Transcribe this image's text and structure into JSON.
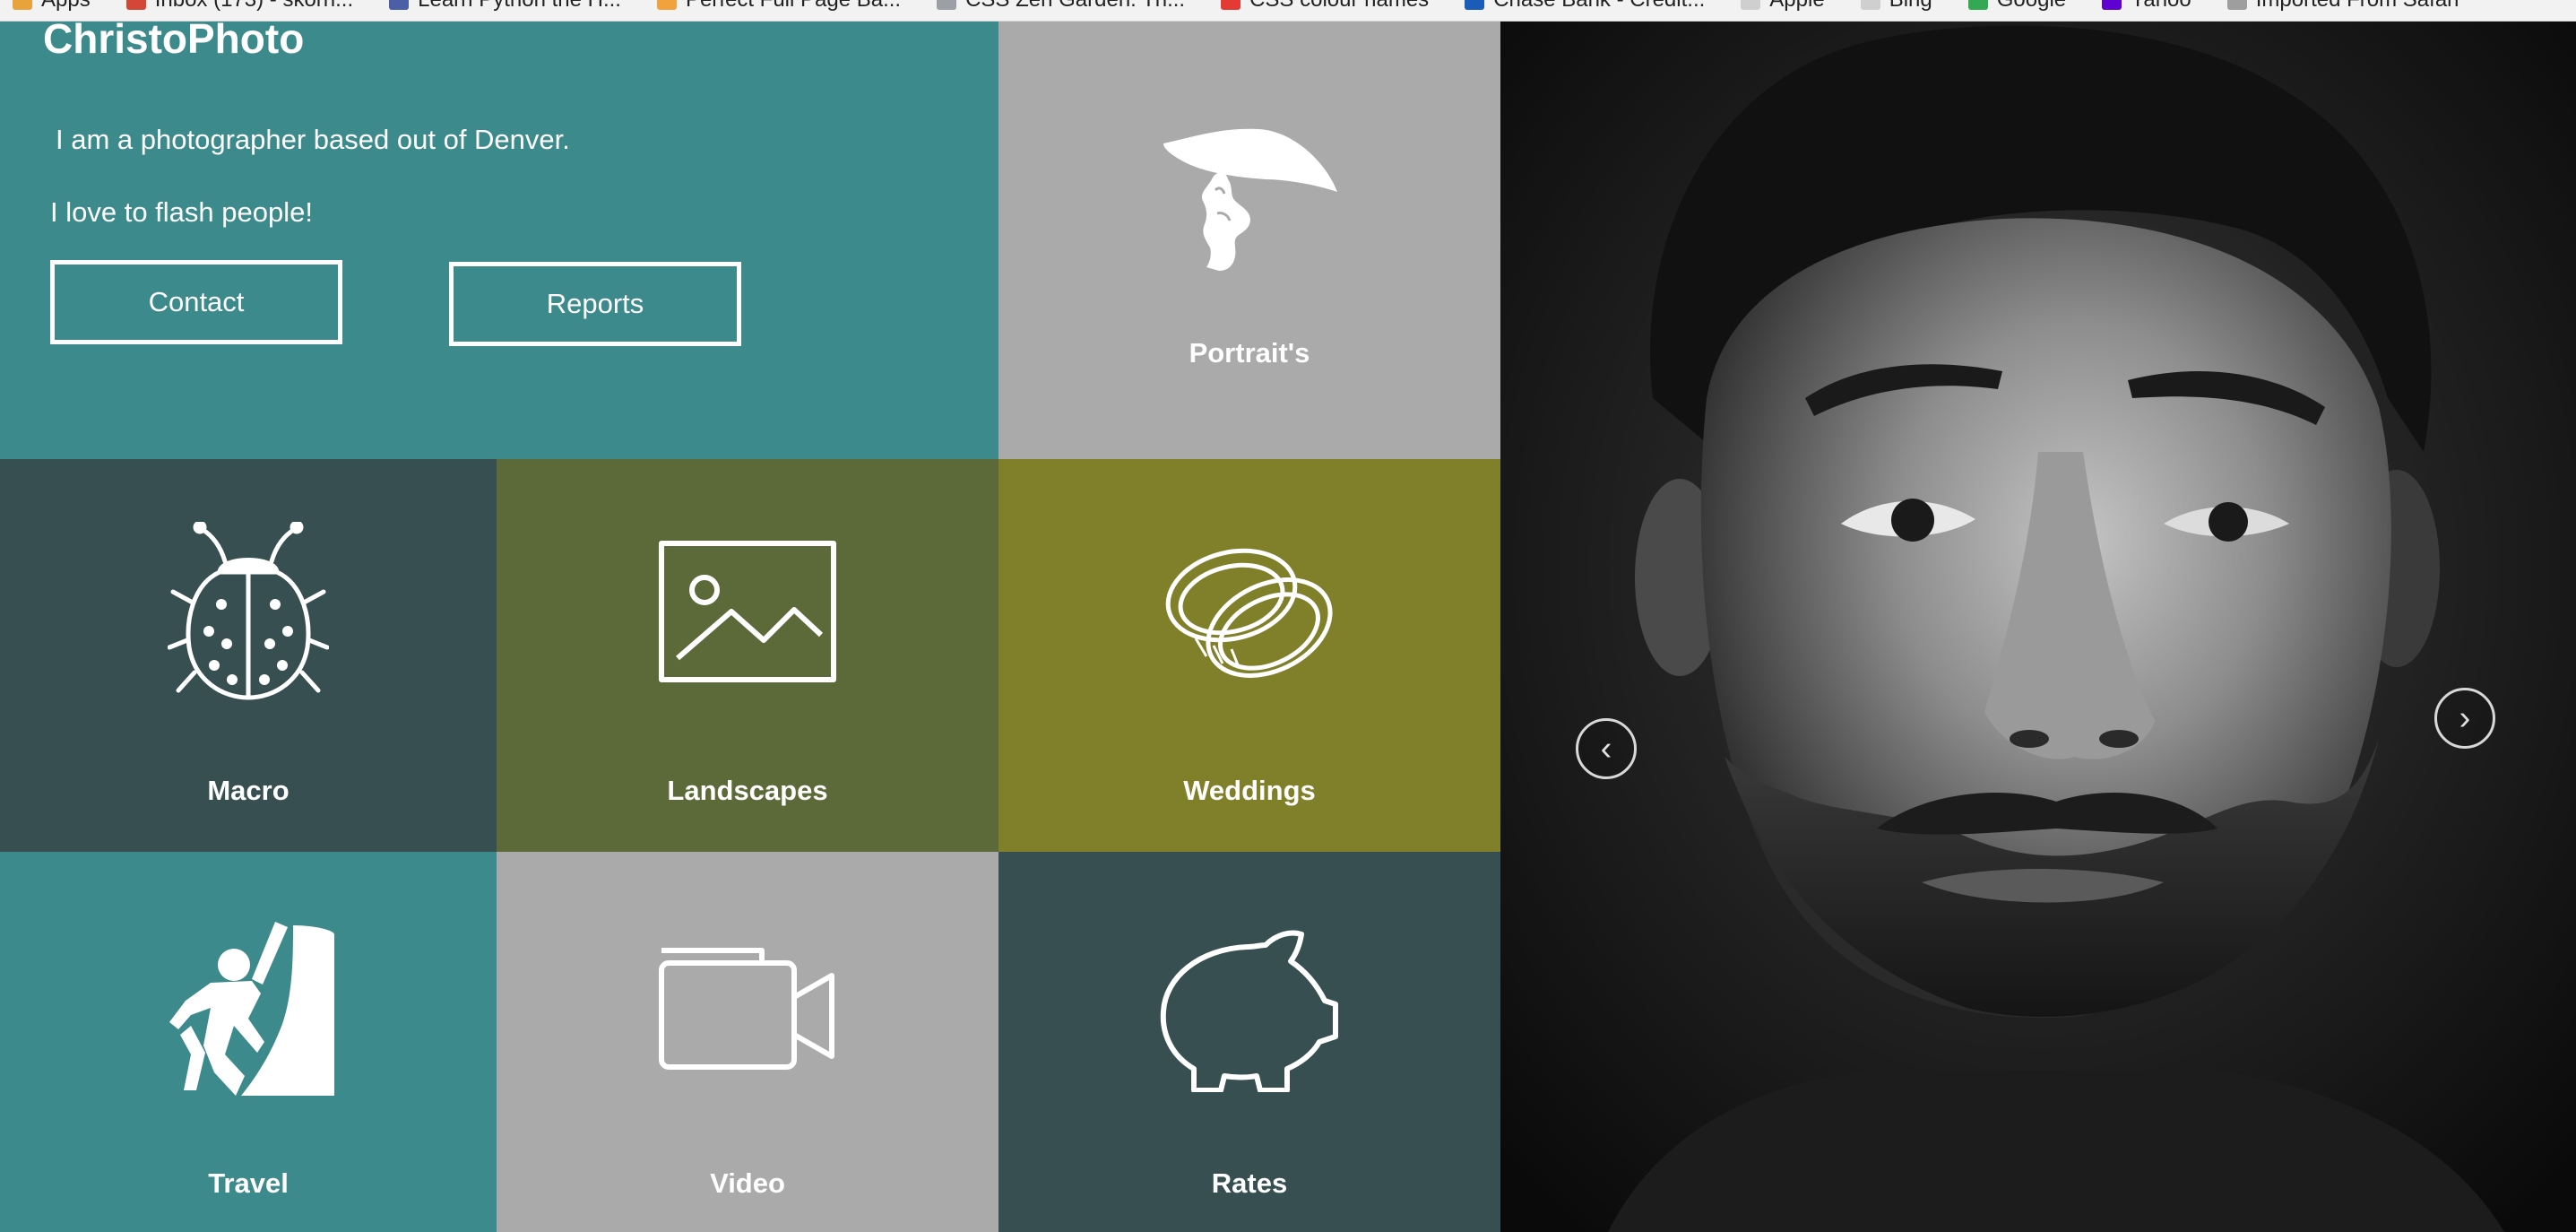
{
  "bookmarks": [
    {
      "label": "Apps",
      "color": "#e8a33d"
    },
    {
      "label": "Inbox (173) - skorn...",
      "color": "#d44638"
    },
    {
      "label": "Learn Python the H...",
      "color": "#4b5fa6"
    },
    {
      "label": "Perfect Full Page Ba...",
      "color": "#f2a23c"
    },
    {
      "label": "CSS Zen Garden: Th...",
      "color": "#9aa0a6"
    },
    {
      "label": "CSS colour names",
      "color": "#e53935"
    },
    {
      "label": "Chase Bank - Credit...",
      "color": "#1a5cb8"
    },
    {
      "label": "Apple",
      "color": "#cfcfcf"
    },
    {
      "label": "Bing",
      "color": "#cfcfcf"
    },
    {
      "label": "Google",
      "color": "#34a853"
    },
    {
      "label": "Yahoo",
      "color": "#5f01d1"
    },
    {
      "label": "Imported From Safari",
      "color": "#9e9e9e"
    }
  ],
  "site": {
    "brand": "ChristoPhoto",
    "intro_line1": "I am a photographer based out of Denver.",
    "intro_line2": "I love to flash people!",
    "contact_label": "Contact",
    "reports_label": "Reports"
  },
  "tiles": {
    "portraits": {
      "label": "Portrait's",
      "icon": "lady-hat-icon",
      "color": "#aaaaaa"
    },
    "macro": {
      "label": "Macro",
      "icon": "ladybug-icon",
      "color": "#374f50"
    },
    "landscapes": {
      "label": "Landscapes",
      "icon": "landscape-picture-icon",
      "color": "#5b6a38"
    },
    "weddings": {
      "label": "Weddings",
      "icon": "wedding-rings-icon",
      "color": "#807f2a"
    },
    "travel": {
      "label": "Travel",
      "icon": "climber-icon",
      "color": "#3c8a8b"
    },
    "video": {
      "label": "Video",
      "icon": "video-camera-icon",
      "color": "#aaaaaa"
    },
    "rates": {
      "label": "Rates",
      "icon": "piggy-bank-icon",
      "color": "#374f50"
    }
  },
  "slider": {
    "prev_icon": "‹",
    "next_icon": "›"
  }
}
